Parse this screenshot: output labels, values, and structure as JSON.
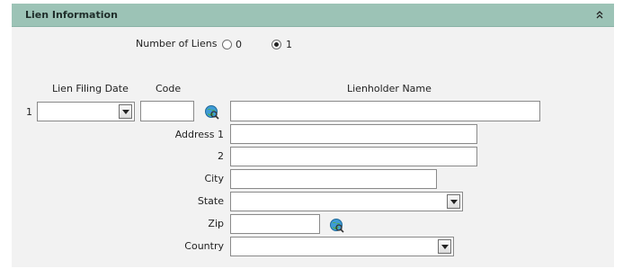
{
  "section": {
    "title": "Lien Information",
    "collapse_icon": "double-chevron-up-icon"
  },
  "lien_count": {
    "label": "Number of Liens",
    "options": [
      "0",
      "1"
    ],
    "selected": "1"
  },
  "columns": {
    "filing_date": "Lien Filing Date",
    "code": "Code",
    "lienholder_name": "Lienholder Name"
  },
  "row": {
    "index": "1",
    "filing_date_value": "",
    "code_value": "",
    "lienholder_name_value": ""
  },
  "address": {
    "address1_label": "Address 1",
    "address2_label": "2",
    "city_label": "City",
    "state_label": "State",
    "zip_label": "Zip",
    "country_label": "Country",
    "address1_value": "",
    "address2_value": "",
    "city_value": "",
    "state_value": "",
    "zip_value": "",
    "country_value": ""
  },
  "icons": {
    "lookup": "globe-search-icon"
  },
  "colors": {
    "header_bg": "#9cc3b6",
    "panel_bg": "#f2f2f2"
  }
}
